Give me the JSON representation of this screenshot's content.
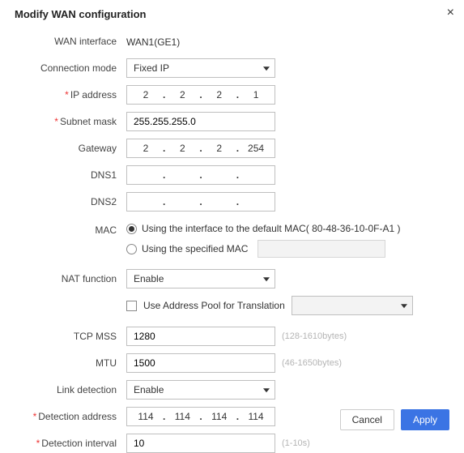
{
  "modal": {
    "title": "Modify WAN configuration"
  },
  "labels": {
    "wan_interface": "WAN interface",
    "connection_mode": "Connection mode",
    "ip_address": "IP address",
    "subnet_mask": "Subnet mask",
    "gateway": "Gateway",
    "dns1": "DNS1",
    "dns2": "DNS2",
    "mac": "MAC",
    "nat_function": "NAT function",
    "tcp_mss": "TCP MSS",
    "mtu": "MTU",
    "link_detection": "Link detection",
    "detection_address": "Detection address",
    "detection_interval": "Detection interval"
  },
  "values": {
    "wan_interface": "WAN1(GE1)",
    "connection_mode": "Fixed IP",
    "ip_address": {
      "o1": "2",
      "o2": "2",
      "o3": "2",
      "o4": "1"
    },
    "subnet_mask": "255.255.255.0",
    "gateway": {
      "o1": "2",
      "o2": "2",
      "o3": "2",
      "o4": "254"
    },
    "dns1": {
      "o1": "",
      "o2": "",
      "o3": "",
      "o4": ""
    },
    "dns2": {
      "o1": "",
      "o2": "",
      "o3": "",
      "o4": ""
    },
    "mac_radio1": "Using the interface to the default MAC( 80-48-36-10-0F-A1 )",
    "mac_radio2": "Using the specified MAC",
    "nat_function": "Enable",
    "use_pool_label": "Use Address Pool for Translation",
    "tcp_mss": "1280",
    "mtu": "1500",
    "link_detection": "Enable",
    "detection_address": {
      "o1": "114",
      "o2": "114",
      "o3": "114",
      "o4": "114"
    },
    "detection_interval": "10"
  },
  "hints": {
    "tcp_mss": "(128-1610bytes)",
    "mtu": "(46-1650bytes)",
    "detection_interval": "(1-10s)"
  },
  "buttons": {
    "cancel": "Cancel",
    "apply": "Apply"
  }
}
